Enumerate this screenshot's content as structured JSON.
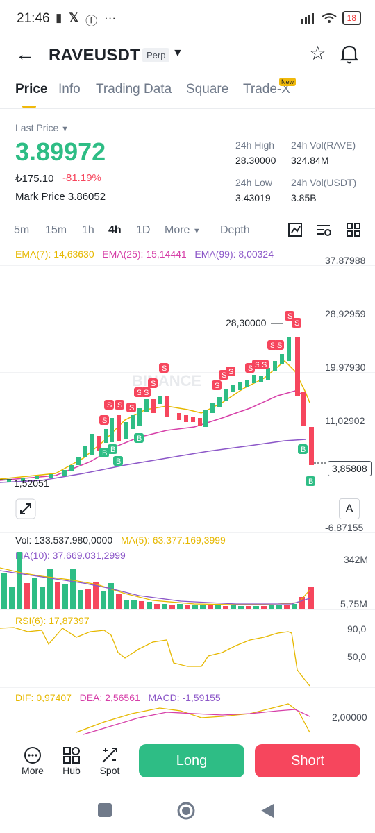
{
  "status_bar": {
    "time": "21:46",
    "battery": "18"
  },
  "header": {
    "pair": "RAVEUSDT",
    "contract_type": "Perp"
  },
  "tabs": [
    {
      "label": "Price",
      "active": true
    },
    {
      "label": "Info"
    },
    {
      "label": "Trading Data"
    },
    {
      "label": "Square"
    },
    {
      "label": "Trade-X",
      "badge": "New"
    }
  ],
  "price_panel": {
    "last_price_label": "Last Price",
    "last_price": "3.89972",
    "fiat_price": "₺175.10",
    "change_pct": "-81.19%",
    "mark_price_label": "Mark Price",
    "mark_price": "3.86052",
    "high_label": "24h High",
    "high": "28.30000",
    "low_label": "24h Low",
    "low": "3.43019",
    "vol_base_label": "24h Vol(RAVE)",
    "vol_base": "324.84M",
    "vol_quote_label": "24h Vol(USDT)",
    "vol_quote": "3.85B"
  },
  "intervals": [
    "5m",
    "15m",
    "1h",
    "4h",
    "1D",
    "More",
    "Depth"
  ],
  "active_interval": "4h",
  "ema": {
    "ema7": "EMA(7): 14,63630",
    "ema25": "EMA(25): 15,14441",
    "ema99": "EMA(99): 8,00324"
  },
  "price_axis": [
    "37,87988",
    "28,92959",
    "19,97930",
    "11,02902",
    "-6,87155"
  ],
  "chart_labels": {
    "high_marker": "28,30000",
    "low_marker": "1,52051",
    "current_price": "3,85808",
    "watermark": "BINANCE",
    "scale_mode": "A"
  },
  "volume": {
    "vol": "Vol: 133.537.980,0000",
    "ma5": "MA(5): 63.377.169,3999",
    "ma10": "MA(10): 37.669.031,2999",
    "axis_top": "342M",
    "axis_bottom": "5,75M"
  },
  "rsi": {
    "label": "RSI(6): 17,87397",
    "axis_top": "90,0",
    "axis_mid": "50,0"
  },
  "macd": {
    "dif": "DIF: 0,97407",
    "dea": "DEA: 2,56561",
    "macd": "MACD: -1,59155",
    "axis": "2,00000"
  },
  "bottom_nav": {
    "more": "More",
    "hub": "Hub",
    "spot": "Spot",
    "long": "Long",
    "short": "Short"
  },
  "colors": {
    "up": "#2ebd85",
    "down": "#f6465d",
    "ema7": "#e6b800",
    "ema25": "#d63fa8",
    "ema99": "#8c57c8",
    "accent": "#f0b90b"
  }
}
